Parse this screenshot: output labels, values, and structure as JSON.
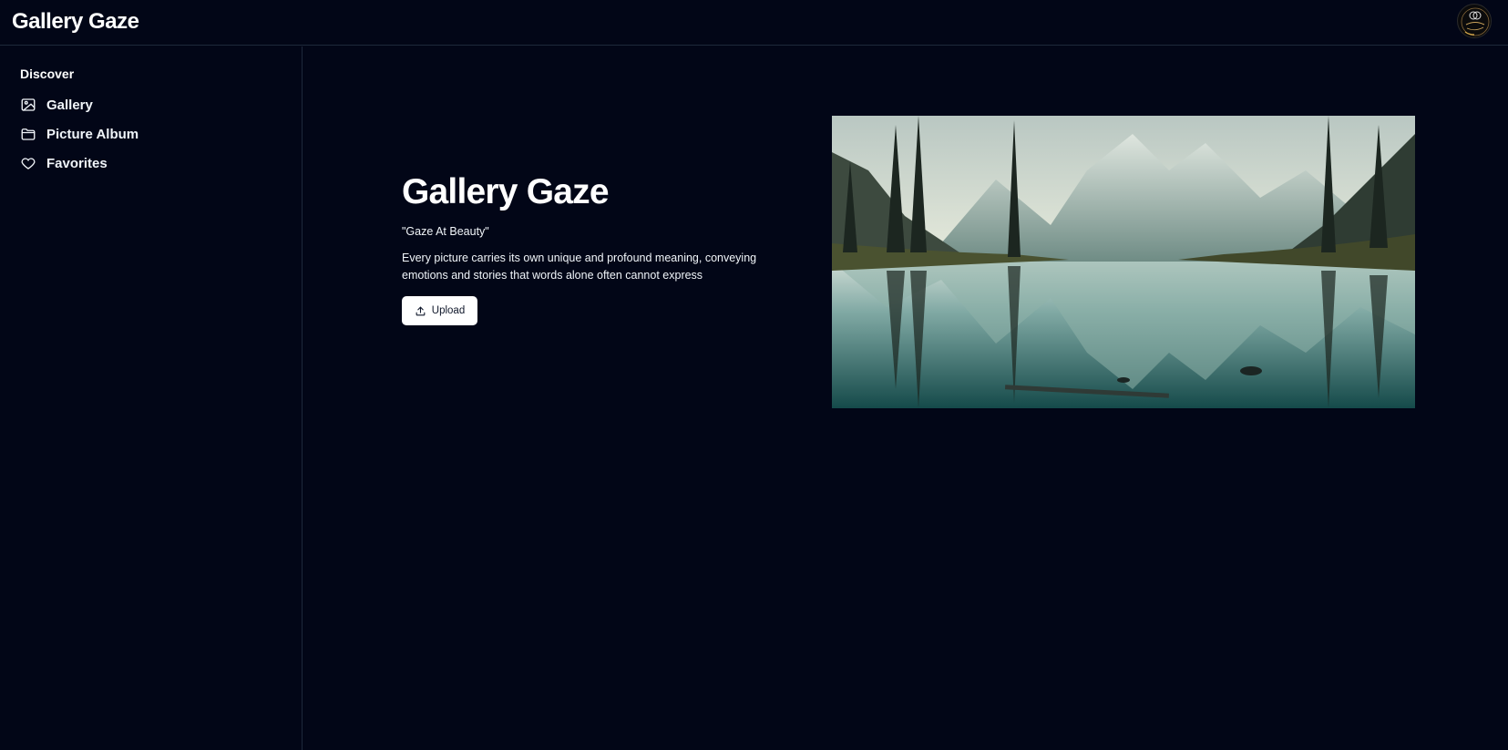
{
  "header": {
    "app_title": "Gallery Gaze",
    "avatar_icon": "gallery-gaze-logo"
  },
  "sidebar": {
    "section_heading": "Discover",
    "items": [
      {
        "label": "Gallery",
        "icon": "image-icon"
      },
      {
        "label": "Picture Album",
        "icon": "folder-icon"
      },
      {
        "label": "Favorites",
        "icon": "heart-icon"
      }
    ]
  },
  "hero": {
    "title": "Gallery Gaze",
    "tagline": "\"Gaze At Beauty\"",
    "description": "Every picture carries its own unique and profound meaning, conveying emotions and stories that words alone often cannot express",
    "upload_label": "Upload",
    "upload_icon": "upload-icon",
    "image_subject": "mountain lake reflection"
  },
  "colors": {
    "background": "#020617",
    "border": "#1e293b",
    "text": "#f8fafc",
    "button_bg": "#ffffff"
  }
}
